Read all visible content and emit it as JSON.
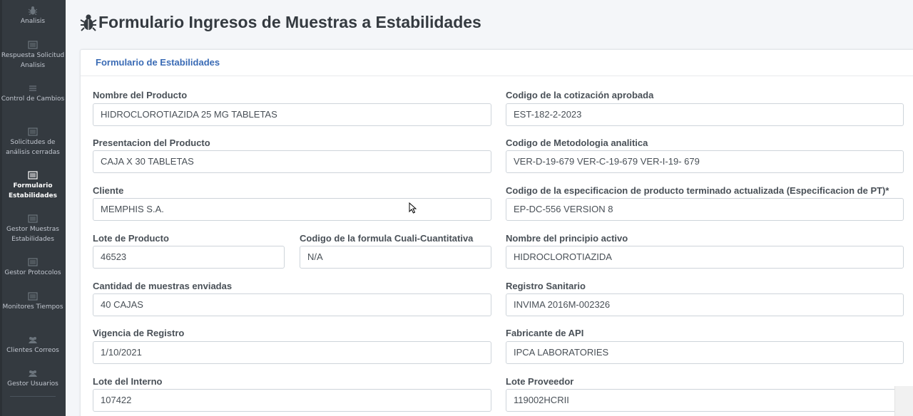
{
  "sidebar": {
    "items": [
      {
        "label": "Analisis",
        "icon": "bug-icon"
      },
      {
        "label": "Respuesta Solicitud Analisis",
        "icon": "list-alt-icon"
      },
      {
        "label": "Control de Cambios",
        "icon": "menu-icon"
      },
      {
        "label": "Solicitudes de análisis cerradas",
        "icon": "list-alt-icon"
      },
      {
        "label": "Formulario Estabilidades",
        "icon": "list-alt-icon",
        "active": true
      },
      {
        "label": "Gestor Muestras Estabilidades",
        "icon": "list-alt-icon"
      },
      {
        "label": "Gestor Protocolos",
        "icon": "list-alt-icon"
      },
      {
        "label": "Monitores Tiempos",
        "icon": "list-alt-icon"
      },
      {
        "label": "Clientes Correos",
        "icon": "users-icon"
      },
      {
        "label": "Gestor Usuarios",
        "icon": "users-icon"
      }
    ]
  },
  "page": {
    "title": "Formulario Ingresos de Muestras a Estabilidades",
    "title_icon": "bug-icon"
  },
  "card": {
    "header": "Formulario de Estabilidades"
  },
  "form": {
    "nombre_producto": {
      "label": "Nombre del Producto",
      "value": "HIDROCLOROTIAZIDA 25 MG TABLETAS"
    },
    "codigo_cotizacion": {
      "label": "Codigo de la cotización aprobada",
      "value": "EST-182-2-2023"
    },
    "presentacion": {
      "label": "Presentacion del Producto",
      "value": "CAJA X 30 TABLETAS"
    },
    "codigo_metodologia": {
      "label": "Codigo de Metodologia analitica",
      "value": "VER-D-19-679 VER-C-19-679 VER-I-19- 679"
    },
    "cliente": {
      "label": "Cliente",
      "value": "MEMPHIS S.A."
    },
    "codigo_especificacion": {
      "label": "Codigo de la especificacion de producto terminado actualizada (Especificacion de PT)*",
      "value": "EP-DC-556 VERSION 8"
    },
    "lote_producto": {
      "label": "Lote de Producto",
      "value": "46523"
    },
    "codigo_formula": {
      "label": "Codigo de la formula Cuali-Cuantitativa",
      "value": "N/A"
    },
    "principio_activo": {
      "label": "Nombre del principio activo",
      "value": "HIDROCLOROTIAZIDA"
    },
    "cantidad_muestras": {
      "label": "Cantidad de muestras enviadas",
      "value": "40 CAJAS"
    },
    "registro_sanitario": {
      "label": "Registro Sanitario",
      "value": "INVIMA 2016M-002326"
    },
    "vigencia_registro": {
      "label": "Vigencia de Registro",
      "value": "1/10/2021"
    },
    "fabricante_api": {
      "label": "Fabricante de API",
      "value": "IPCA LABORATORIES"
    },
    "lote_interno": {
      "label": "Lote del Interno",
      "value": "107422"
    },
    "lote_proveedor": {
      "label": "Lote Proveedor",
      "value": "119002HCRII"
    }
  },
  "colors": {
    "sidebar_bg": "#343a40",
    "card_header_text": "#3a6bb5",
    "label_text": "#495057"
  }
}
